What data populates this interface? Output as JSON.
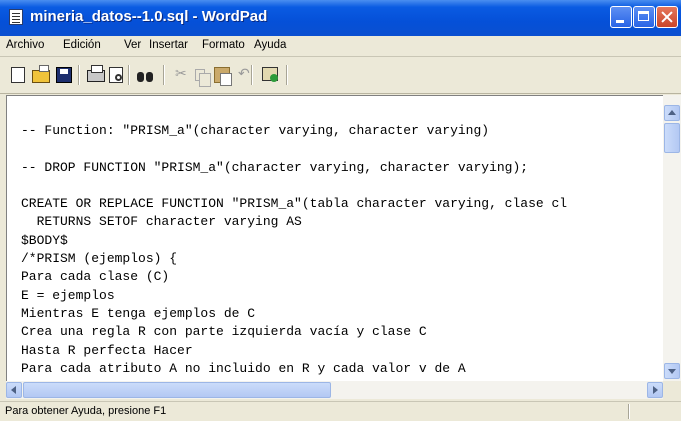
{
  "window": {
    "title": "mineria_datos--1.0.sql - WordPad"
  },
  "menu": [
    "Archivo",
    "Edición",
    "Ver",
    "Insertar",
    "Formato",
    "Ayuda"
  ],
  "toolbar": {
    "icons": [
      "new-document-icon",
      "open-folder-icon",
      "save-icon",
      "print-icon",
      "print-preview-icon",
      "find-icon",
      "cut-icon",
      "copy-icon",
      "paste-icon",
      "undo-icon",
      "insert-object-icon"
    ]
  },
  "document": {
    "lines": [
      "-- Function: \"PRISM_a\"(character varying, character varying)",
      "",
      "-- DROP FUNCTION \"PRISM_a\"(character varying, character varying);",
      "",
      "CREATE OR REPLACE FUNCTION \"PRISM_a\"(tabla character varying, clase cl",
      "  RETURNS SETOF character varying AS",
      "$BODY$",
      "/*PRISM (ejemplos) {",
      "Para cada clase (C)",
      "E = ejemplos",
      "Mientras E tenga ejemplos de C",
      "Crea una regla R con parte izquierda vacía y clase C",
      "Hasta R perfecta Hacer",
      "Para cada atributo A no incluido en R y cada valor v de A"
    ]
  },
  "statusbar": {
    "text": "Para obtener Ayuda, presione F1"
  },
  "colors": {
    "titlebar": "#0a5be2",
    "close_button": "#c9452a",
    "chrome": "#ece9d8"
  }
}
